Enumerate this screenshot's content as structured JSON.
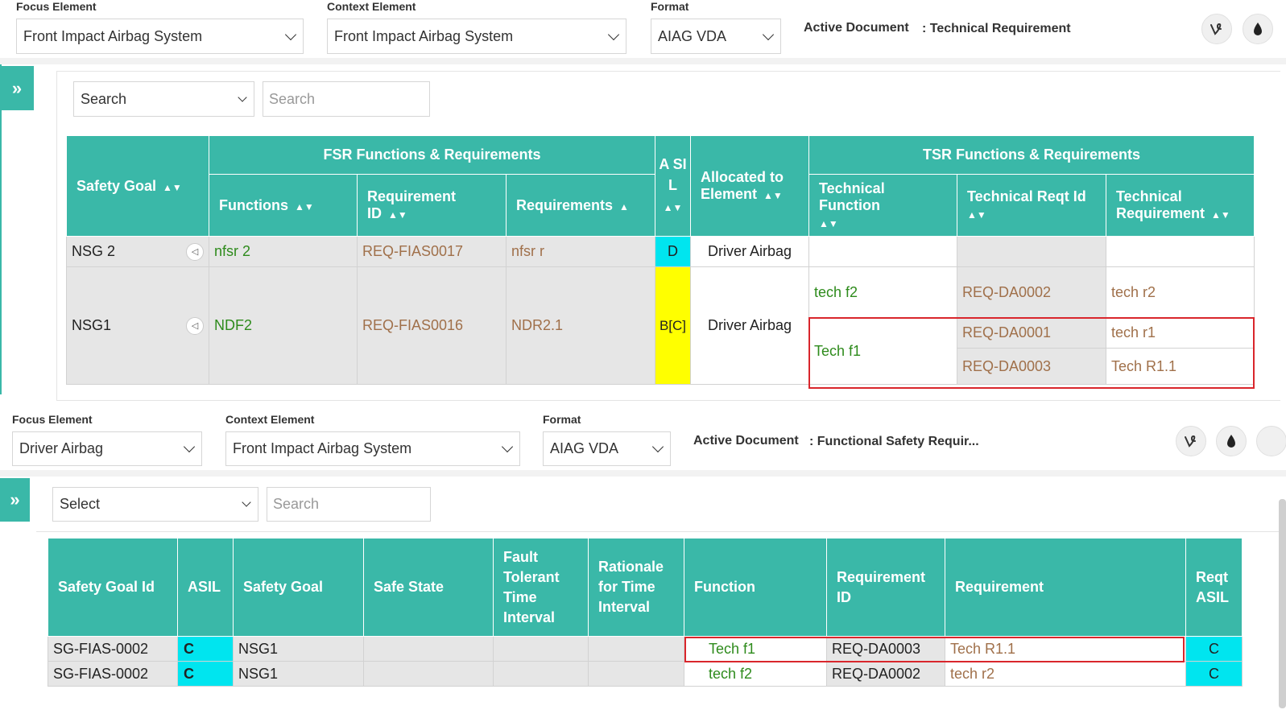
{
  "top": {
    "focus_label": "Focus Element",
    "focus_value": "Front Impact Airbag System",
    "context_label": "Context Element",
    "context_value": "Front Impact Airbag System",
    "format_label": "Format",
    "format_value": "AIAG VDA",
    "active_doc_label": "Active Document",
    "active_doc_value": ": Technical Requirement",
    "search_select": "Search",
    "search_placeholder": "Search",
    "headers": {
      "safety_goal": "Safety Goal",
      "fsr_group": "FSR Functions & Requirements",
      "functions": "Functions",
      "requirement_id": "Requirement ID",
      "requirements": "Requirements",
      "asil": "A SI L",
      "allocated": "Allocated to Element",
      "tsr_group": "TSR Functions & Requirements",
      "technical_function": "Technical Function",
      "technical_reqt_id": "Technical Reqt Id",
      "technical_requirement": "Technical Requirement"
    },
    "rows": [
      {
        "safety_goal": "NSG 2",
        "function": "nfsr 2",
        "req_id": "REQ-FIAS0017",
        "requirement": "nfsr r",
        "asil": "D",
        "allocated": "Driver Airbag"
      },
      {
        "safety_goal": "NSG1",
        "function": "NDF2",
        "req_id": "REQ-FIAS0016",
        "requirement": "NDR2.1",
        "asil": "B[C]",
        "allocated": "Driver Airbag",
        "tech": [
          {
            "function": "tech f2",
            "id": "REQ-DA0002",
            "req": "tech r2"
          },
          {
            "function": "Tech f1",
            "id": "REQ-DA0001",
            "req": "tech r1"
          },
          {
            "function": "",
            "id": "REQ-DA0003",
            "req": "Tech R1.1"
          }
        ]
      }
    ]
  },
  "bottom": {
    "focus_label": "Focus Element",
    "focus_value": "Driver Airbag",
    "context_label": "Context Element",
    "context_value": "Front Impact Airbag System",
    "format_label": "Format",
    "format_value": "AIAG VDA",
    "active_doc_label": "Active Document",
    "active_doc_value": ": Functional Safety Requir...",
    "search_select": "Select",
    "search_placeholder": "Search",
    "headers": {
      "safety_goal_id": "Safety Goal Id",
      "asil": "ASIL",
      "safety_goal": "Safety Goal",
      "safe_state": "Safe State",
      "ftti": "Fault Tolerant Time Interval",
      "rationale": "Rationale for Time Interval",
      "function": "Function",
      "requirement_id": "Requirement ID",
      "requirement": "Requirement",
      "reqt_asil": "Reqt ASIL"
    },
    "rows": [
      {
        "sg_id": "SG-FIAS-0002",
        "asil": "C",
        "sg": "NSG1",
        "function": "Tech f1",
        "req_id": "REQ-DA0003",
        "req": "Tech R1.1",
        "reqt_asil": "C"
      },
      {
        "sg_id": "SG-FIAS-0002",
        "asil": "C",
        "sg": "NSG1",
        "function": "tech f2",
        "req_id": "REQ-DA0002",
        "req": "tech r2",
        "reqt_asil": "C"
      }
    ]
  },
  "icons": {
    "vine": "vine-icon",
    "drop": "drop-icon",
    "expand": "double-chevron-right-icon"
  }
}
